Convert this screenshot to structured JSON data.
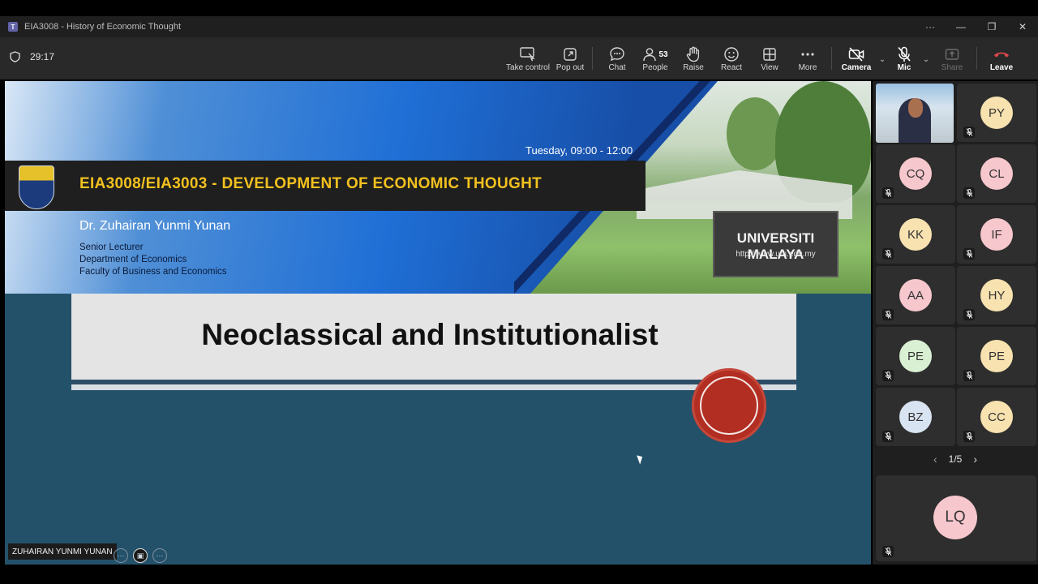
{
  "window": {
    "title": "EIA3008 - History of Economic Thought",
    "controls": [
      "···",
      "—",
      "❐",
      "✕"
    ]
  },
  "toolbar": {
    "timer": "29:17",
    "take_control": "Take control",
    "pop_out": "Pop out",
    "chat": "Chat",
    "people": "People",
    "people_count": "53",
    "raise": "Raise",
    "react": "React",
    "view": "View",
    "more": "More",
    "camera": "Camera",
    "mic": "Mic",
    "share": "Share",
    "leave": "Leave",
    "leave_color": "#e0484b"
  },
  "slide": {
    "session": "Tuesday, 09:00 - 12:00",
    "course": "EIA3008/EIA3003 -  DEVELOPMENT OF ECONOMIC THOUGHT",
    "lecturer": "Dr. Zuhairan Yunmi Yunan",
    "role_lines": [
      "Senior Lecturer",
      "Department of Economics",
      "Faculty of Business and Economics"
    ],
    "university_sign": "UNIVERSITI MALAYA",
    "university_url": "http://www.um.edu.my",
    "title": "Neoclassical and Institutionalist"
  },
  "presenter": {
    "name": "ZUHAIRAN YUNMI YUNAN"
  },
  "gallery": {
    "participants": [
      {
        "initials": "PY",
        "color": "#f7e2b0"
      },
      {
        "initials": "CQ",
        "color": "#f6c7cd"
      },
      {
        "initials": "CL",
        "color": "#f6c7cd"
      },
      {
        "initials": "KK",
        "color": "#f7e2b0"
      },
      {
        "initials": "IF",
        "color": "#f6c7cd"
      },
      {
        "initials": "AA",
        "color": "#f6c7cd"
      },
      {
        "initials": "HY",
        "color": "#f7e2b0"
      },
      {
        "initials": "PE",
        "color": "#d9f0d3"
      },
      {
        "initials": "PE",
        "color": "#f7e2b0"
      },
      {
        "initials": "BZ",
        "color": "#d8e4f2"
      },
      {
        "initials": "CC",
        "color": "#f7e2b0"
      }
    ],
    "page": "1/5",
    "spotlight": {
      "initials": "LQ",
      "color": "#f6c7cd"
    }
  }
}
